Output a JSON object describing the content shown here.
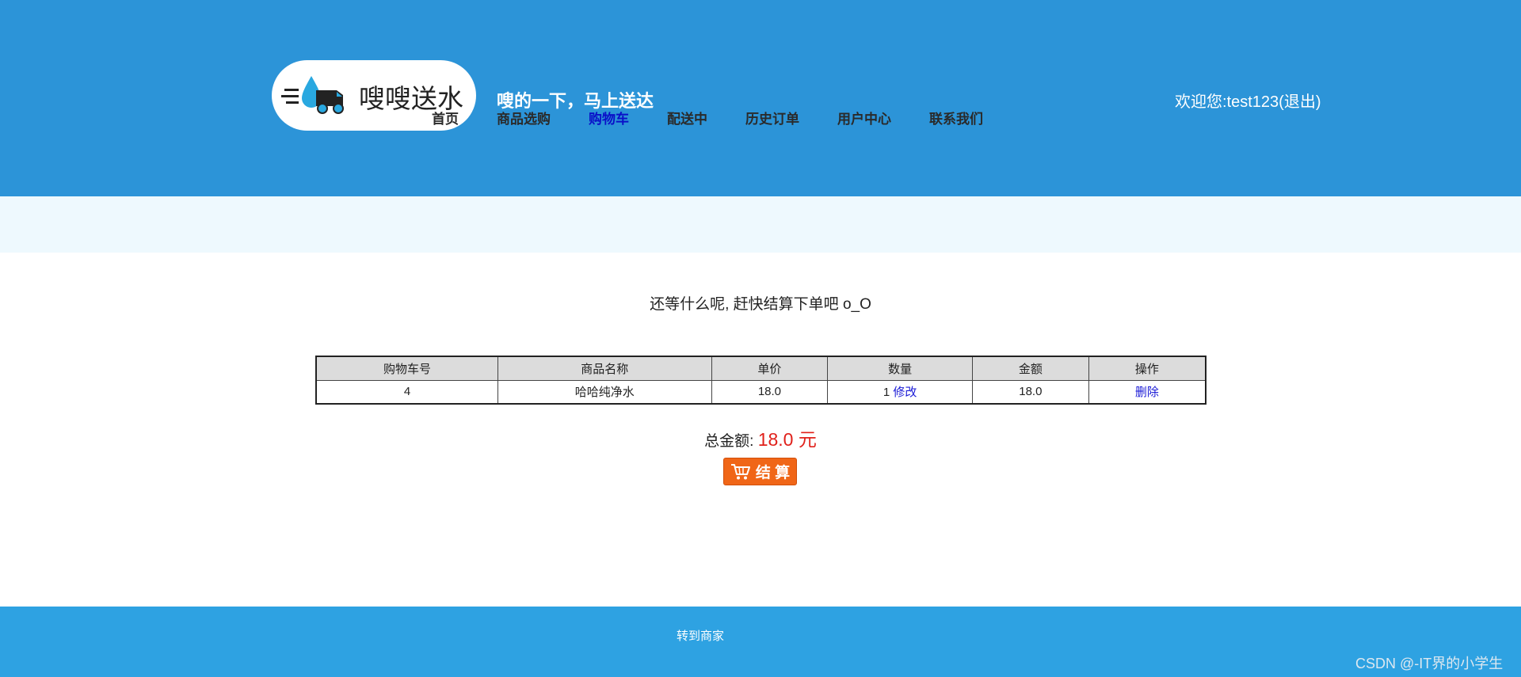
{
  "header": {
    "logo_text": "嗖嗖送水",
    "slogan": "嗖的一下，马上送达",
    "nav": [
      "首页",
      "商品选购",
      "购物车",
      "配送中",
      "历史订单",
      "用户中心",
      "联系我们"
    ],
    "welcome_prefix": "欢迎您:",
    "username": "test123",
    "logout": "(退出)"
  },
  "main": {
    "prompt": "还等什么呢, 赶快结算下单吧 o_O",
    "table": {
      "headers": [
        "购物车号",
        "商品名称",
        "单价",
        "数量",
        "金额",
        "操作"
      ],
      "rows": [
        {
          "id": "4",
          "name": "哈哈纯净水",
          "price": "18.0",
          "qty": "1",
          "edit": "修改",
          "amount": "18.0",
          "delete": "删除"
        }
      ]
    },
    "total_label": "总金额:",
    "total_value": "18.0 元",
    "checkout_label": "结 算"
  },
  "footer": {
    "merchant_link": "转到商家",
    "watermark": "CSDN @-IT界的小学生"
  },
  "colors": {
    "header_bg": "#2c94d8",
    "band_bg": "#eef9fe",
    "footer_bg": "#2ea2e2",
    "active_nav": "#0a10c8",
    "total_red": "#e0201a",
    "checkout_orange": "#f06617"
  },
  "icons": [
    "water-delivery-logo-icon",
    "cart-icon"
  ]
}
